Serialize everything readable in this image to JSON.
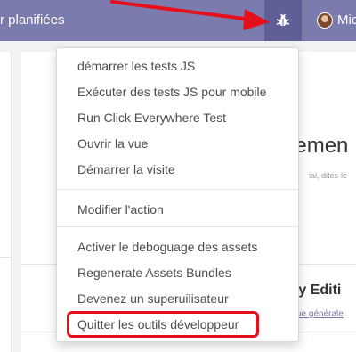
{
  "navbar": {
    "menu_text": "r planifiées",
    "debug_icon": "bug-icon",
    "user_name": "Mic"
  },
  "background": {
    "heading": "uemen",
    "subtext": "ial, dites-le",
    "heading2": "ty Editi",
    "link": "ue générale"
  },
  "debug_menu": {
    "group1": [
      "démarrer les tests JS",
      "Exécuter des tests JS pour mobile",
      "Run Click Everywhere Test",
      "Ouvrir la vue",
      "Démarrer la visite"
    ],
    "group2": [
      "Modifier l'action"
    ],
    "group3": [
      "Activer le deboguage des assets",
      "Regenerate Assets Bundles",
      "Devenez un superuilisateur",
      "Quitter les outils développeur"
    ]
  },
  "colors": {
    "navbar": "#7c7bad",
    "debug_active": "#5f5e97",
    "annotation": "#e5101b"
  }
}
